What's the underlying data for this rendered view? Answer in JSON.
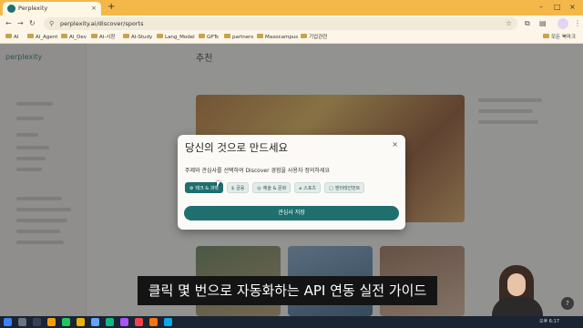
{
  "browser": {
    "tab_title": "Perplexity",
    "tab_close": "×",
    "new_tab": "+",
    "window_controls": [
      "–",
      "□",
      "×"
    ],
    "nav": {
      "back": "←",
      "forward": "→",
      "reload": "↻"
    },
    "url": "perplexity.ai/discover/sports",
    "bookmarks": [
      "AI",
      "AI_Agent",
      "AI_Dev",
      "AI-시장",
      "AI-Study",
      "Lang_Model",
      "GPTs",
      "partners",
      "Maxocampus",
      "기업관련"
    ],
    "all_bookmarks": "모든 북마크"
  },
  "page": {
    "brand": "perplexity",
    "heading": "추천"
  },
  "modal": {
    "title": "당신의 것으로 만드세요",
    "close": "×",
    "description": "주제와 관심사를 선택하여 Discover 경험을 사용자 정의하세요",
    "chips": [
      {
        "icon": "⚙",
        "label": "테크 & 과학",
        "active": true
      },
      {
        "icon": "$",
        "label": "금융",
        "active": false
      },
      {
        "icon": "◎",
        "label": "예술 & 문화",
        "active": false
      },
      {
        "icon": "⌀",
        "label": "스포츠",
        "active": false
      },
      {
        "icon": "▢",
        "label": "엔터테인먼트",
        "active": false
      }
    ],
    "save_label": "관심사 저장"
  },
  "caption": "클릭 몇 번으로 자동화하는 API 연동 실전 가이드",
  "taskbar": {
    "clock": "오후 6:17"
  },
  "colors": {
    "accent": "#1f6f6f",
    "tabstrip": "#f4b84a"
  }
}
